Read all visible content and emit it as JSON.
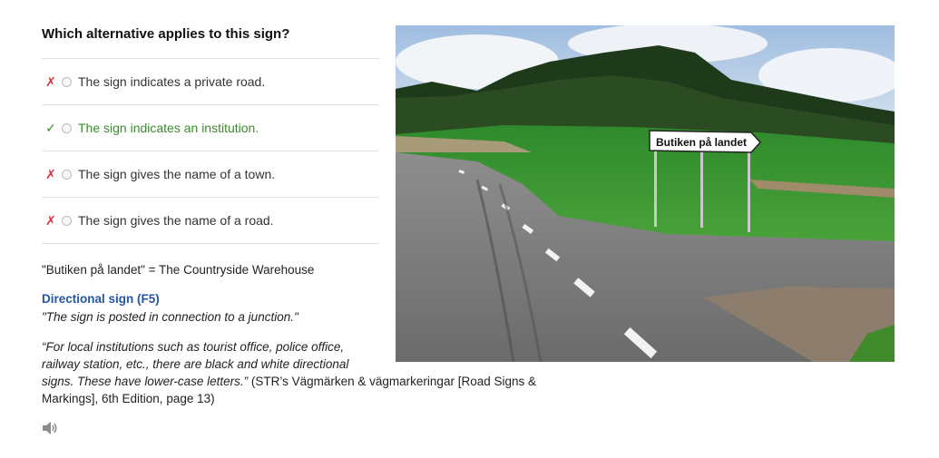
{
  "question": "Which alternative applies to this sign?",
  "answers": [
    {
      "label": "The sign indicates a private road.",
      "mark": "✗",
      "status": "wrong"
    },
    {
      "label": "The sign indicates an institution.",
      "mark": "✓",
      "status": "correct"
    },
    {
      "label": "The sign gives the name of a town.",
      "mark": "✗",
      "status": "wrong"
    },
    {
      "label": "The sign gives the name of a road.",
      "mark": "✗",
      "status": "wrong"
    }
  ],
  "explanation": {
    "translation": "\"Butiken på landet\" = The Countryside Warehouse",
    "sign_title": "Directional sign (F5)",
    "sign_quote": "\"The sign is posted in connection to a junction.\"",
    "quote_line1": "“For local institutions such as tourist office, police office,",
    "quote_line2": "railway station, etc., there are black and white directional",
    "quote_line3": "signs. These have lower-case letters.”",
    "source_tail": " (STR’s Vägmärken & vägmarkeringar [Road Signs &",
    "source_line2": "Markings], 6th Edition, page 13)"
  },
  "photo": {
    "sign_text": "Butiken på landet"
  },
  "icons": {
    "audio": "speaker-icon"
  },
  "colors": {
    "correct": "#3c8a2e",
    "wrong": "#d8313b",
    "link": "#2456a6"
  }
}
